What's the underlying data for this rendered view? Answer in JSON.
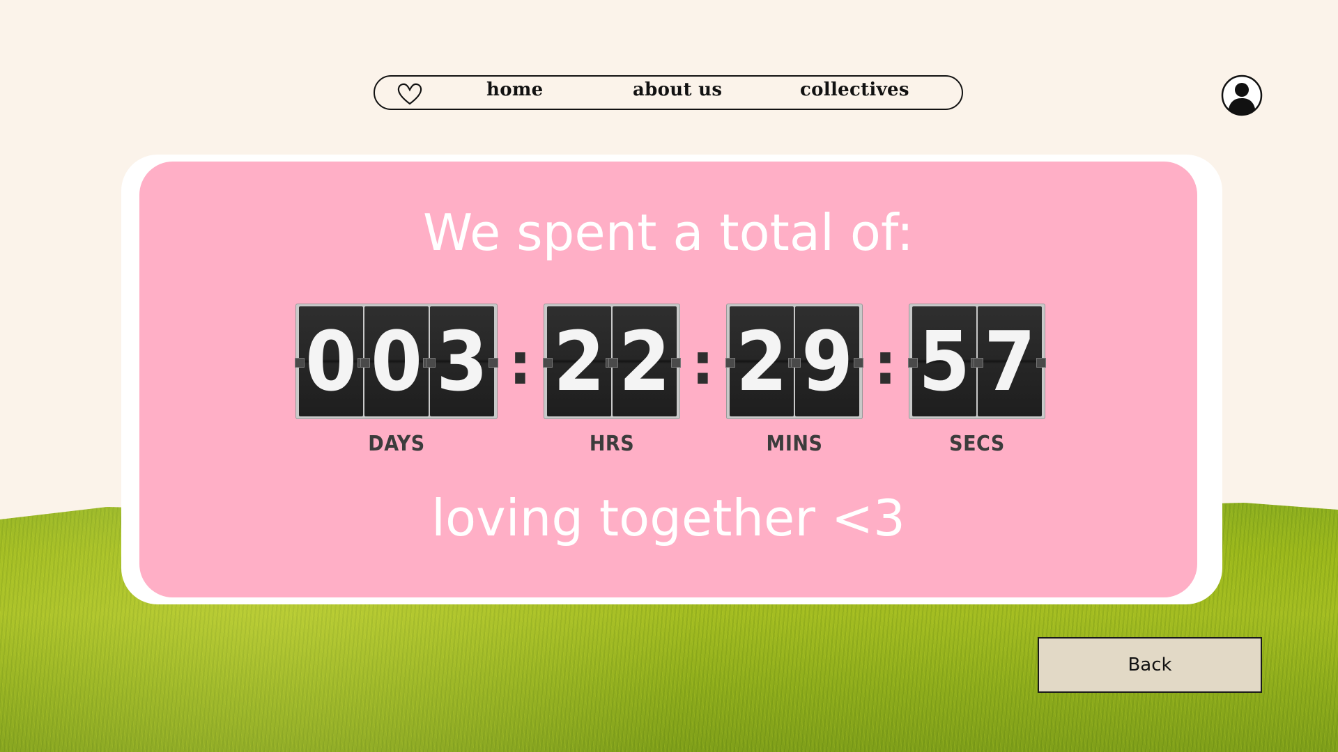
{
  "nav": {
    "home": "home",
    "about": "about us",
    "collectives": "collectives"
  },
  "card": {
    "headline": "We spent a total of:",
    "subline": "loving together <3"
  },
  "counter": {
    "days": [
      "0",
      "0",
      "3"
    ],
    "hours": [
      "2",
      "2"
    ],
    "minutes": [
      "2",
      "9"
    ],
    "seconds": [
      "5",
      "7"
    ],
    "separator": ":",
    "labels": {
      "days": "DAYS",
      "hours": "HRS",
      "minutes": "MINS",
      "seconds": "SECS"
    }
  },
  "back_button": "Back",
  "colors": {
    "background": "#fbf3ea",
    "card_pink": "#ffafc6",
    "flip_digit": "#262626",
    "button": "#e2d9c6"
  }
}
